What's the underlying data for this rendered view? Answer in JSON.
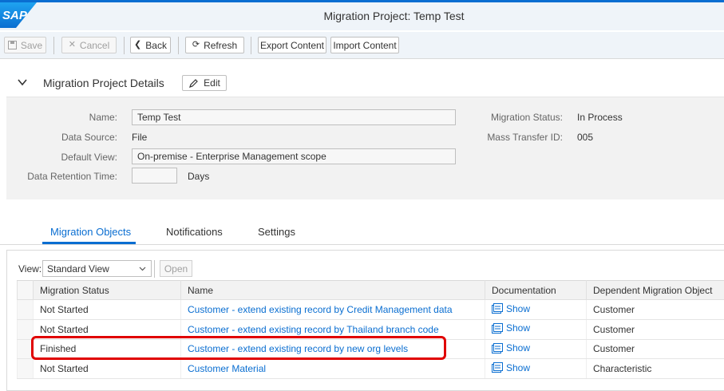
{
  "shell": {
    "logo_text": "SAP",
    "title": "Migration Project: Temp Test"
  },
  "toolbar": {
    "save": "Save",
    "cancel": "Cancel",
    "back": "Back",
    "refresh": "Refresh",
    "export": "Export Content",
    "import": "Import Content"
  },
  "details": {
    "title": "Migration Project Details",
    "edit": "Edit",
    "name_label": "Name:",
    "name_value": "Temp Test",
    "source_label": "Data Source:",
    "source_value": "File",
    "view_label": "Default View:",
    "view_value": "On-premise - Enterprise Management scope",
    "retention_label": "Data Retention Time:",
    "retention_value": "",
    "retention_unit": "Days",
    "status_label": "Migration Status:",
    "status_value": "In Process",
    "transfer_label": "Mass Transfer ID:",
    "transfer_value": "005"
  },
  "tabs": [
    "Migration Objects",
    "Notifications",
    "Settings"
  ],
  "table_toolbar": {
    "view_label": "View:",
    "view_value": "Standard View",
    "open": "Open"
  },
  "table": {
    "headers": [
      "Migration Status",
      "Name",
      "Documentation",
      "Dependent Migration Object"
    ],
    "rows": [
      {
        "status": "Not Started",
        "name": "Customer - extend existing record by Credit Management data",
        "doc": "Show",
        "dep": "Customer"
      },
      {
        "status": "Not Started",
        "name": "Customer - extend existing record by Thailand branch code",
        "doc": "Show",
        "dep": "Customer"
      },
      {
        "status": "Finished",
        "name": "Customer - extend existing record by new org levels",
        "doc": "Show",
        "dep": "Customer"
      },
      {
        "status": "Not Started",
        "name": "Customer Material",
        "doc": "Show",
        "dep": "Characteristic"
      }
    ]
  },
  "colors": {
    "accent": "#0a6ed1",
    "highlight": "#e00000",
    "logo": "#1b8ee8"
  },
  "icons": [
    "save-icon",
    "cancel-icon",
    "back-icon",
    "refresh-icon",
    "edit-pencil-icon",
    "chevron-down-icon",
    "document-icon"
  ]
}
